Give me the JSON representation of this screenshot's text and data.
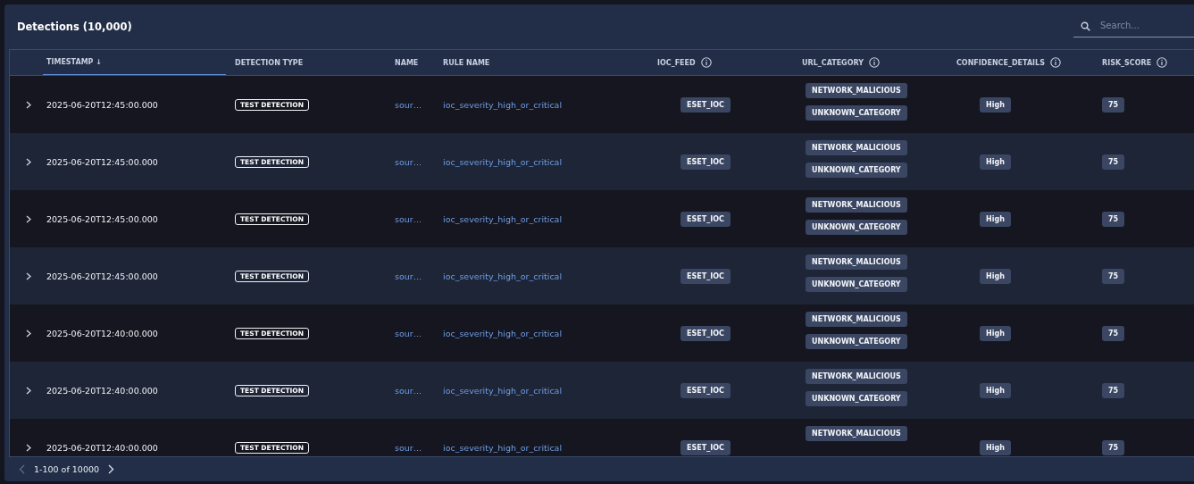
{
  "panel": {
    "title": "Detections (10,000)"
  },
  "search": {
    "placeholder": "Search..."
  },
  "table": {
    "columns": [
      {
        "label": "TIMESTAMP",
        "sort_indicator": "↓",
        "sorted": true,
        "info": false
      },
      {
        "label": "DETECTION TYPE",
        "sorted": false,
        "info": false
      },
      {
        "label": "NAME",
        "sorted": false,
        "info": false
      },
      {
        "label": "RULE NAME",
        "sorted": false,
        "info": false
      },
      {
        "label": "IOC_FEED",
        "sorted": false,
        "info": true
      },
      {
        "label": "URL_CATEGORY",
        "sorted": false,
        "info": true
      },
      {
        "label": "CONFIDENCE_DETAILS",
        "sorted": false,
        "info": true
      },
      {
        "label": "RISK_SCORE",
        "sorted": false,
        "info": true
      }
    ],
    "rows": [
      {
        "timestamp": "2025-06-20T12:45:00.000",
        "detection_type": "TEST DETECTION",
        "name": "sour…",
        "rule_name": "ioc_severity_high_or_critical",
        "ioc_feed": "ESET_IOC",
        "url_categories": [
          "NETWORK_MALICIOUS",
          "UNKNOWN_CATEGORY"
        ],
        "confidence": "High",
        "risk_score": "75"
      },
      {
        "timestamp": "2025-06-20T12:45:00.000",
        "detection_type": "TEST DETECTION",
        "name": "sour…",
        "rule_name": "ioc_severity_high_or_critical",
        "ioc_feed": "ESET_IOC",
        "url_categories": [
          "NETWORK_MALICIOUS",
          "UNKNOWN_CATEGORY"
        ],
        "confidence": "High",
        "risk_score": "75"
      },
      {
        "timestamp": "2025-06-20T12:45:00.000",
        "detection_type": "TEST DETECTION",
        "name": "sour…",
        "rule_name": "ioc_severity_high_or_critical",
        "ioc_feed": "ESET_IOC",
        "url_categories": [
          "NETWORK_MALICIOUS",
          "UNKNOWN_CATEGORY"
        ],
        "confidence": "High",
        "risk_score": "75"
      },
      {
        "timestamp": "2025-06-20T12:45:00.000",
        "detection_type": "TEST DETECTION",
        "name": "sour…",
        "rule_name": "ioc_severity_high_or_critical",
        "ioc_feed": "ESET_IOC",
        "url_categories": [
          "NETWORK_MALICIOUS",
          "UNKNOWN_CATEGORY"
        ],
        "confidence": "High",
        "risk_score": "75"
      },
      {
        "timestamp": "2025-06-20T12:40:00.000",
        "detection_type": "TEST DETECTION",
        "name": "sour…",
        "rule_name": "ioc_severity_high_or_critical",
        "ioc_feed": "ESET_IOC",
        "url_categories": [
          "NETWORK_MALICIOUS",
          "UNKNOWN_CATEGORY"
        ],
        "confidence": "High",
        "risk_score": "75"
      },
      {
        "timestamp": "2025-06-20T12:40:00.000",
        "detection_type": "TEST DETECTION",
        "name": "sour…",
        "rule_name": "ioc_severity_high_or_critical",
        "ioc_feed": "ESET_IOC",
        "url_categories": [
          "NETWORK_MALICIOUS",
          "UNKNOWN_CATEGORY"
        ],
        "confidence": "High",
        "risk_score": "75"
      },
      {
        "timestamp": "2025-06-20T12:40:00.000",
        "detection_type": "TEST DETECTION",
        "name": "sour…",
        "rule_name": "ioc_severity_high_or_critical",
        "ioc_feed": "ESET_IOC",
        "url_categories": [
          "NETWORK_MALICIOUS"
        ],
        "confidence": "High",
        "risk_score": "75"
      }
    ]
  },
  "pagination": {
    "range": "1-100 of 10000",
    "prev_disabled": true,
    "next_disabled": false
  }
}
